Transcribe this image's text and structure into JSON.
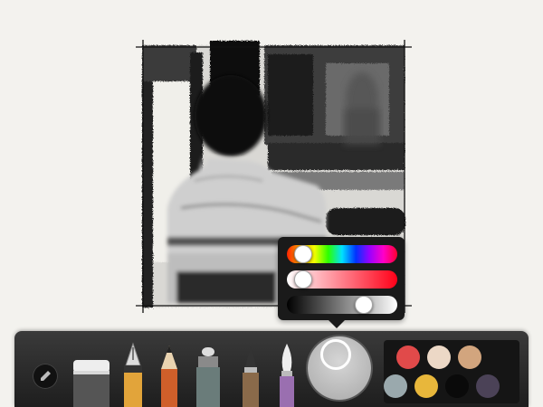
{
  "picker": {
    "hue_level": 0.08,
    "saturation_level": 0.08,
    "value_level": 0.72
  },
  "current_color": "#aaaaaa",
  "tools": [
    {
      "icon": "eraser-icon",
      "color": "#d8d8d8"
    },
    {
      "icon": "fountain-pen-icon",
      "color": "#e2a43a"
    },
    {
      "icon": "pencil-icon",
      "color": "#cf5f2a"
    },
    {
      "icon": "marker-icon",
      "color": "#6a7c7a"
    },
    {
      "icon": "brush-icon",
      "color": "#8a6a4a"
    },
    {
      "icon": "watercolor-brush-icon",
      "color": "#9a6fb0"
    }
  ],
  "swatches": [
    "#e14a4a",
    "#ecd8c6",
    "#d2a57e",
    "#9aa9ad",
    "#e8b73b",
    "#0a0a0a",
    "#4b4257"
  ]
}
